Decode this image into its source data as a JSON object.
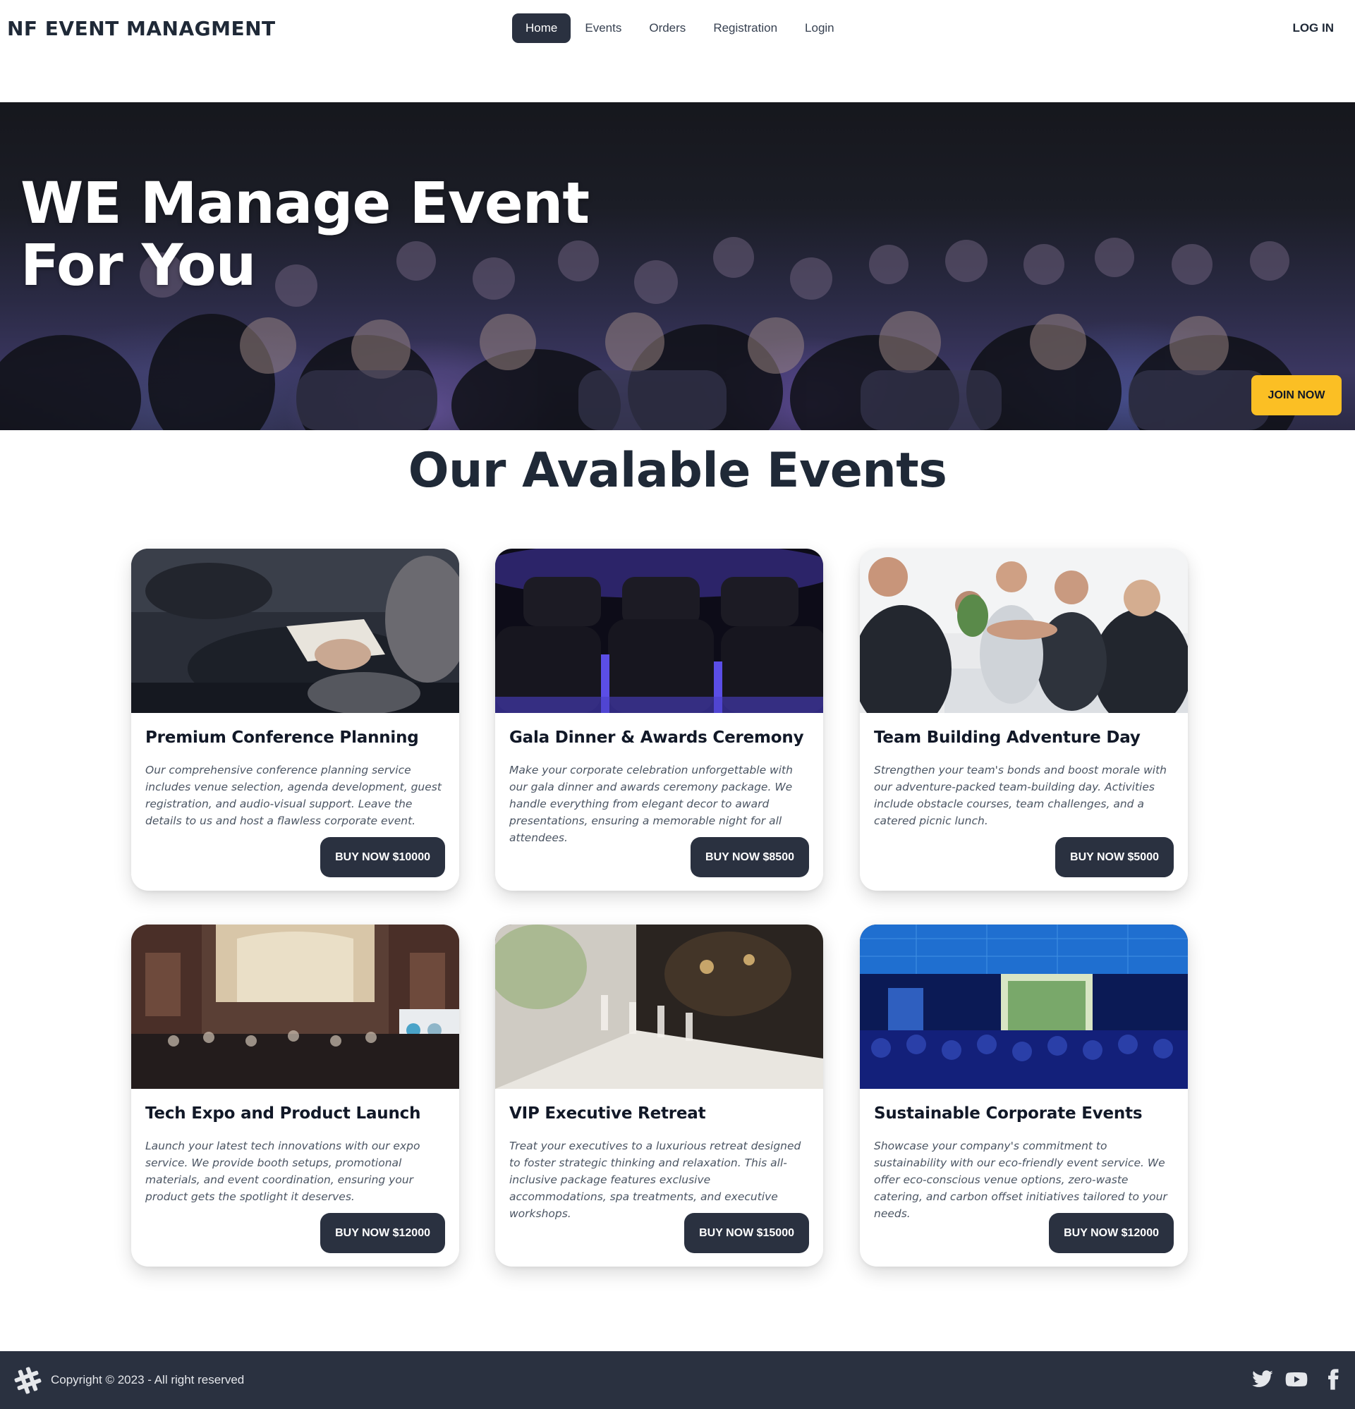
{
  "brand": "NF EVENT MANAGMENT",
  "nav": {
    "items": [
      {
        "label": "Home",
        "active": true
      },
      {
        "label": "Events",
        "active": false
      },
      {
        "label": "Orders",
        "active": false
      },
      {
        "label": "Registration",
        "active": false
      },
      {
        "label": "Login",
        "active": false
      }
    ],
    "login_label": "LOG IN"
  },
  "hero": {
    "title_line1": "WE Manage Event",
    "title_line2": "For You",
    "cta_label": "JOIN NOW",
    "image_icon": "audience-photo"
  },
  "section": {
    "title": "Our Avalable Events"
  },
  "events": [
    {
      "title": "Premium Conference Planning",
      "description": "Our comprehensive conference planning service includes venue selection, agenda development, guest registration, and audio-visual support. Leave the details to us and host a flawless corporate event.",
      "button": "BUY NOW $10000",
      "image_icon": "conference-notes-photo"
    },
    {
      "title": "Gala Dinner & Awards Ceremony",
      "description": "Make your corporate celebration unforgettable with our gala dinner and awards ceremony package. We handle everything from elegant decor to award presentations, ensuring a memorable night for all attendees.",
      "button": "BUY NOW $8500",
      "image_icon": "auditorium-chairs-photo"
    },
    {
      "title": "Team Building Adventure Day",
      "description": "Strengthen your team's bonds and boost morale with our adventure-packed team-building day. Activities include obstacle courses, team challenges, and a catered picnic lunch.",
      "button": "BUY NOW $5000",
      "image_icon": "team-handshake-photo"
    },
    {
      "title": "Tech Expo and Product Launch",
      "description": "Launch your latest tech innovations with our expo service. We provide booth setups, promotional materials, and event coordination, ensuring your product gets the spotlight it deserves.",
      "button": "BUY NOW $12000",
      "image_icon": "expo-hall-photo"
    },
    {
      "title": "VIP Executive Retreat",
      "description": "Treat your executives to a luxurious retreat designed to foster strategic thinking and relaxation. This all-inclusive package features exclusive accommodations, spa treatments, and executive workshops.",
      "button": "BUY NOW $15000",
      "image_icon": "dinner-table-photo"
    },
    {
      "title": "Sustainable Corporate Events",
      "description": "Showcase your company's commitment to sustainability with our eco-friendly event service. We offer eco-conscious venue options, zero-waste catering, and carbon offset initiatives tailored to your needs.",
      "button": "BUY NOW $12000",
      "image_icon": "presentation-hall-photo"
    }
  ],
  "footer": {
    "copyright": "Copyright © 2023 - All right reserved",
    "logo_icon": "hashtag-logo-icon",
    "social": [
      "twitter-icon",
      "youtube-icon",
      "facebook-icon"
    ]
  },
  "colors": {
    "primary_dark": "#2a3140",
    "accent_yellow": "#fbbf24",
    "text_dark": "#1f2937",
    "text_muted": "#4b5563"
  }
}
